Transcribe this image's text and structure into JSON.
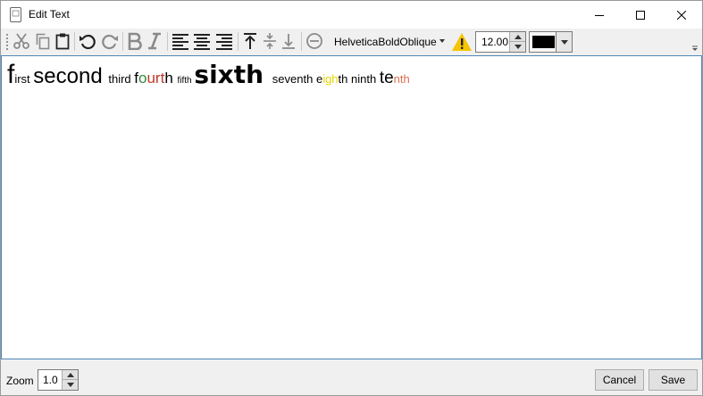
{
  "window": {
    "title": "Edit Text"
  },
  "toolbar": {
    "font_name": "HelveticaBoldOblique",
    "font_size": "12.00",
    "text_color": "#000000",
    "warning_color": "#f6c400"
  },
  "editor": {
    "runs": [
      {
        "text": "f",
        "size": 30,
        "color": "#000000",
        "family": "Liberation Sans",
        "weight": "normal"
      },
      {
        "text": "irst ",
        "size": 13,
        "color": "#000000",
        "family": "Liberation Sans",
        "weight": "normal"
      },
      {
        "text": "second ",
        "size": 24,
        "color": "#000000",
        "family": "Liberation Sans",
        "weight": "normal"
      },
      {
        "text": "third ",
        "size": 13,
        "color": "#000000",
        "family": "Liberation Sans",
        "weight": "normal"
      },
      {
        "text": "f",
        "size": 17,
        "color": "#000000",
        "family": "Liberation Sans",
        "weight": "normal"
      },
      {
        "text": "o",
        "size": 17,
        "color": "#2e8b3c",
        "family": "Liberation Sans",
        "weight": "normal"
      },
      {
        "text": "urt",
        "size": 17,
        "color": "#c0392b",
        "family": "Liberation Sans",
        "weight": "normal"
      },
      {
        "text": "h ",
        "size": 17,
        "color": "#000000",
        "family": "Liberation Sans",
        "weight": "normal"
      },
      {
        "text": "fifth ",
        "size": 10,
        "color": "#000000",
        "family": "Liberation Sans",
        "weight": "normal"
      },
      {
        "text": "sixth ",
        "size": 28,
        "color": "#000000",
        "family": "DejaVu Sans",
        "weight": "bold"
      },
      {
        "text": "seventh ",
        "size": 13,
        "color": "#000000",
        "family": "Liberation Sans",
        "weight": "normal"
      },
      {
        "text": "e",
        "size": 13,
        "color": "#000000",
        "family": "Liberation Sans",
        "weight": "normal"
      },
      {
        "text": "igh",
        "size": 13,
        "color": "#e6d600",
        "family": "Liberation Sans",
        "weight": "normal"
      },
      {
        "text": "th ninth ",
        "size": 13,
        "color": "#000000",
        "family": "Liberation Sans",
        "weight": "normal"
      },
      {
        "text": "te",
        "size": 19,
        "color": "#000000",
        "family": "Liberation Sans",
        "weight": "normal"
      },
      {
        "text": "nth",
        "size": 13,
        "color": "#d9704f",
        "family": "Liberation Sans",
        "weight": "normal"
      }
    ]
  },
  "status": {
    "zoom_label": "Zoom",
    "zoom_value": "1.0",
    "cancel_label": "Cancel",
    "save_label": "Save"
  }
}
